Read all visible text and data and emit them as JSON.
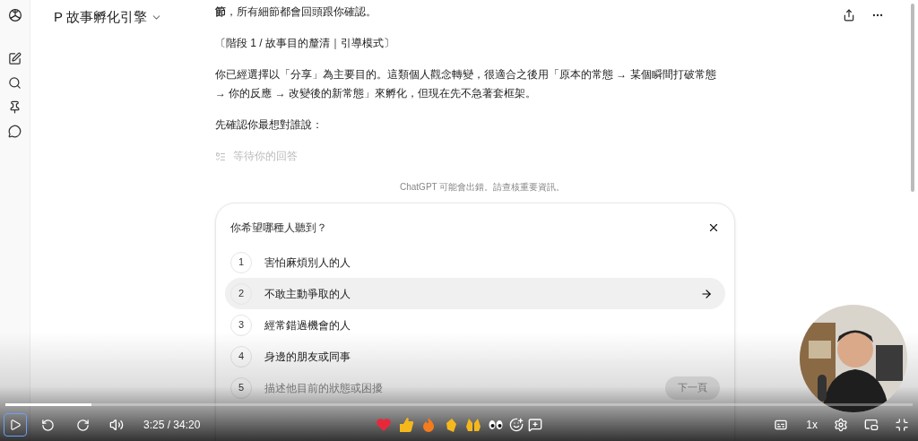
{
  "header": {
    "title": "P 故事孵化引擎"
  },
  "messages": [
    {
      "text": "**節**，所有細節都會回頭跟你確認。"
    },
    {
      "text": "〔階段 1 / 故事目的釐清｜引導模式〕"
    },
    {
      "text": "你已經選擇以「分享」為主要目的。這類個人觀念轉變，很適合之後用「原本的常態 → 某個瞬間打破常態 → 你的反應 → 改變後的新常態」來孵化，但現在先不急著套框架。"
    },
    {
      "text": "先確認你最想對誰說："
    }
  ],
  "status": "等待你的回答",
  "disclaimer": "ChatGPT 可能會出錯。請查核重要資訊。",
  "question": {
    "title": "你希望哪種人聽到？",
    "options": [
      {
        "kind": "choice",
        "number": "1",
        "label": "害怕麻煩別人的人",
        "selected": false
      },
      {
        "kind": "choice",
        "number": "2",
        "label": "不敢主動爭取的人",
        "selected": true
      },
      {
        "kind": "choice",
        "number": "3",
        "label": "經常錯過機會的人",
        "selected": false
      },
      {
        "kind": "choice",
        "number": "4",
        "label": "身邊的朋友或同事",
        "selected": false
      },
      {
        "kind": "input",
        "number": "5",
        "placeholder": "描述他目前的狀態或困擾",
        "selected": false
      }
    ],
    "next_button": "下一頁"
  },
  "player": {
    "progress": {
      "level": 0.095
    },
    "time": "3:25 / 34:20",
    "speed": "1x"
  }
}
